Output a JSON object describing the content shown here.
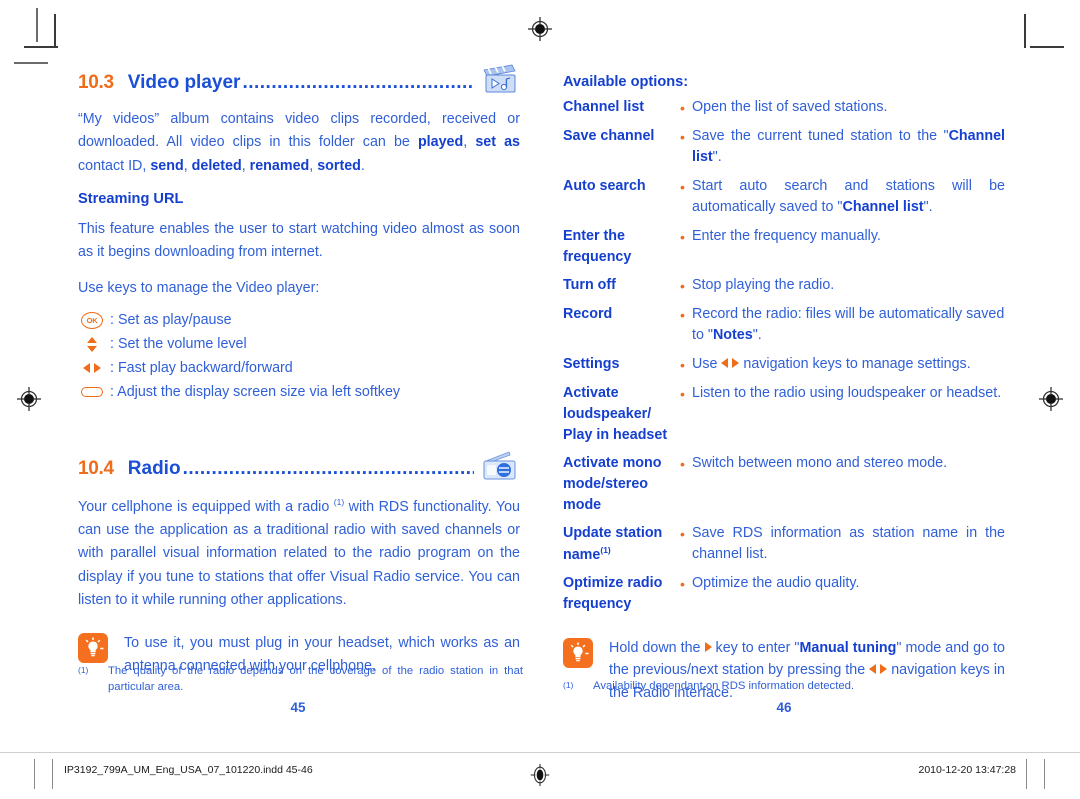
{
  "left_page": {
    "section_video": {
      "number": "10.3",
      "title": "Video player",
      "dots": "..................................................................",
      "icon": "video-clapperboard-icon",
      "intro_part1": "“My videos” album contains video clips recorded, received or downloaded. All video clips in this folder can be ",
      "intro_bold1": "played",
      "intro_mid1": ", ",
      "intro_bold2": "set as",
      "intro_mid2": " contact ID, ",
      "intro_bold3": "send",
      "intro_mid3": ", ",
      "intro_bold4": "deleted",
      "intro_mid4": ", ",
      "intro_bold5": "renamed",
      "intro_mid5": ", ",
      "intro_bold6": "sorted",
      "intro_end": ".",
      "subheading": "Streaming URL",
      "paragraph": "This feature enables the user to start watching video almost as soon as it begins downloading from internet.",
      "keys_intro": "Use keys to manage the Video player:",
      "keys": [
        {
          "glyph": "ok-key-icon",
          "label": "OK",
          "text": ": Set as play/pause"
        },
        {
          "glyph": "up-down-key-icon",
          "label": "",
          "text": ": Set the volume level"
        },
        {
          "glyph": "left-right-key-icon",
          "label": "",
          "text": ": Fast play backward/forward"
        },
        {
          "glyph": "softkey-icon",
          "label": "",
          "text": ": Adjust the display screen size via left softkey"
        }
      ]
    },
    "section_radio": {
      "number": "10.4",
      "title": "Radio",
      "dots": "..............................................................................",
      "icon": "radio-icon",
      "paragraph_a": "Your cellphone is equipped with a radio ",
      "paragraph_footnote_mark": "(1)",
      "paragraph_b": " with RDS functionality. You can use the application as a traditional radio with saved channels or with parallel visual information related to the radio program on the display if you tune to stations that offer Visual Radio service. You can listen to it while running other applications.",
      "tip": {
        "icon": "lightbulb-tip-icon",
        "text": "To use it, you must plug in your headset, which works as an antenna connected with your cellphone."
      }
    },
    "footnote": {
      "mark": "(1)",
      "text": "The quality of the radio depends on the coverage of the radio station in that particular area."
    },
    "page_number": "45"
  },
  "right_page": {
    "options_heading": "Available options:",
    "bullet": "•",
    "options": [
      {
        "name": "Channel list",
        "name_sup": "",
        "desc_pre": "Open the list of saved stations.",
        "desc_bold": "",
        "desc_post": ""
      },
      {
        "name": "Save channel",
        "name_sup": "",
        "desc_pre": "Save the current tuned station to the \"",
        "desc_bold": "Channel list",
        "desc_post": "\"."
      },
      {
        "name": "Auto search",
        "name_sup": "",
        "desc_pre": "Start auto search and stations will be automatically saved to \"",
        "desc_bold": "Channel list",
        "desc_post": "\"."
      },
      {
        "name": "Enter the frequency",
        "name_sup": "",
        "desc_pre": "Enter the frequency manually.",
        "desc_bold": "",
        "desc_post": ""
      },
      {
        "name": "Turn off",
        "name_sup": "",
        "desc_pre": "Stop playing the radio.",
        "desc_bold": "",
        "desc_post": ""
      },
      {
        "name": "Record",
        "name_sup": "",
        "desc_pre": "Record the radio: files will be automatically saved to \"",
        "desc_bold": "Notes",
        "desc_post": "\"."
      },
      {
        "name": "Settings",
        "name_sup": "",
        "desc_pre": "Use ",
        "desc_inline_icon": "left-right-navigation-keys-icon",
        "desc_bold": "",
        "desc_post": " navigation keys to manage settings."
      },
      {
        "name": "Activate loudspeaker/ Play in headset",
        "name_sup": "",
        "desc_pre": "Listen to the radio using loudspeaker or headset.",
        "desc_bold": "",
        "desc_post": ""
      },
      {
        "name": "Activate mono mode/stereo mode",
        "name_sup": "",
        "desc_pre": "Switch between mono and stereo mode.",
        "desc_bold": "",
        "desc_post": ""
      },
      {
        "name": "Update station name",
        "name_sup": "(1)",
        "desc_pre": "Save RDS information as station name in the channel list.",
        "desc_bold": "",
        "desc_post": ""
      },
      {
        "name": "Optimize radio frequency",
        "name_sup": "",
        "desc_pre": "Optimize the audio quality.",
        "desc_bold": "",
        "desc_post": ""
      }
    ],
    "tip": {
      "icon": "lightbulb-tip-icon",
      "text_a": "Hold down the ",
      "icon_right": "right-navigation-key-icon",
      "text_b": " key to enter \"",
      "bold": "Manual tuning",
      "text_c": "\" mode and go to the previous/next station by pressing the ",
      "icon_leftright": "left-right-navigation-keys-icon",
      "text_d": " navigation keys in the Radio interface."
    },
    "footnote": {
      "mark": "(1)",
      "text": "Availability dependant on RDS information detected."
    },
    "page_number": "46"
  },
  "print_bar": {
    "file_name": "IP3192_799A_UM_Eng_USA_07_101220.indd   45-46",
    "timestamp": "2010-12-20   13:47:28"
  },
  "colors": {
    "orange": "#ef6c1a",
    "blue_heading": "#1540cf",
    "blue_body": "#2f5fd8",
    "tip_icon_bg": "#f4701f"
  }
}
